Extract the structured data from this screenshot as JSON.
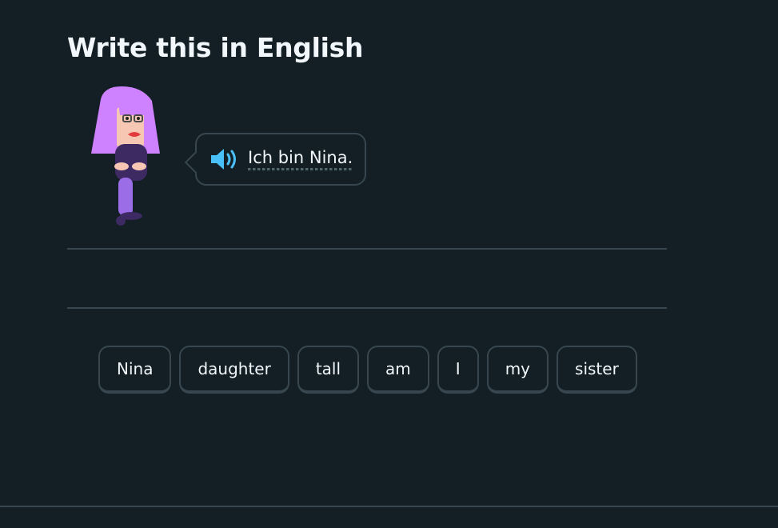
{
  "challenge": {
    "title": "Write this in English"
  },
  "prompt": {
    "text": "Ich bin Nina.",
    "audio_icon": "speaker-icon"
  },
  "character": {
    "name": "character-illustration"
  },
  "word_bank": {
    "words": [
      "Nina",
      "daughter",
      "tall",
      "am",
      "I",
      "my",
      "sister"
    ]
  },
  "colors": {
    "background": "#131f24",
    "border": "#37464f",
    "text": "#f1f7fb",
    "speaker": "#49c0f8",
    "character_hair": "#ce82ff"
  }
}
